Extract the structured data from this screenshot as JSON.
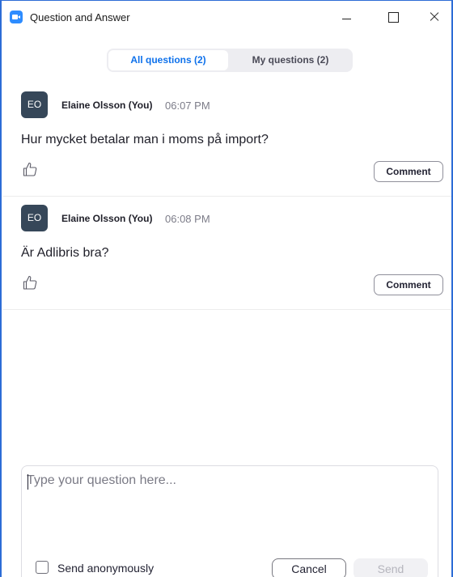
{
  "window": {
    "title": "Question and Answer"
  },
  "tabs": [
    {
      "label": "All questions (2)",
      "selected": true
    },
    {
      "label": "My questions (2)",
      "selected": false
    }
  ],
  "questions": [
    {
      "initials": "EO",
      "author": "Elaine Olsson (You)",
      "time": "06:07 PM",
      "text": "Hur mycket betalar man i moms på import?",
      "comment_label": "Comment",
      "like_icon": "thumbs-up-icon"
    },
    {
      "initials": "EO",
      "author": "Elaine Olsson (You)",
      "time": "06:08 PM",
      "text": "Är Adlibris bra?",
      "comment_label": "Comment",
      "like_icon": "thumbs-up-icon"
    }
  ],
  "compose": {
    "placeholder": "Type your question here...",
    "value": "",
    "anonymous_label": "Send anonymously",
    "anonymous_checked": false,
    "cancel_label": "Cancel",
    "send_label": "Send"
  },
  "colors": {
    "accent": "#0e71eb",
    "avatar_bg": "#364759",
    "window_border": "#2d6cd6"
  }
}
